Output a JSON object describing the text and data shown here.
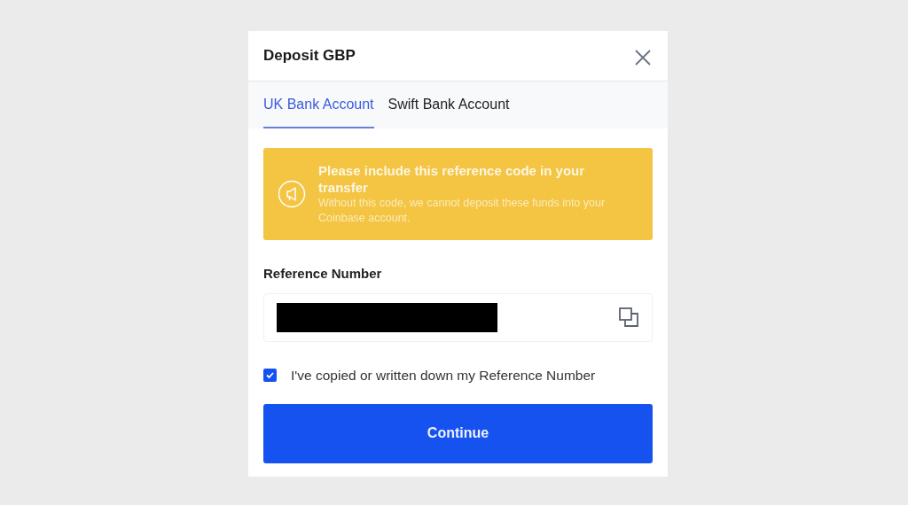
{
  "dialog": {
    "title": "Deposit GBP"
  },
  "tabs": [
    {
      "label": "UK Bank Account",
      "selected": true
    },
    {
      "label": "Swift Bank Account",
      "selected": false
    }
  ],
  "notice": {
    "title": "Please include this reference code in your transfer",
    "message": "Without this code, we cannot deposit these funds into your Coinbase account."
  },
  "reference": {
    "label": "Reference Number",
    "redacted": true
  },
  "confirm": {
    "label": "I've copied or written down my Reference Number",
    "checked": true
  },
  "button": {
    "label": "Continue"
  }
}
